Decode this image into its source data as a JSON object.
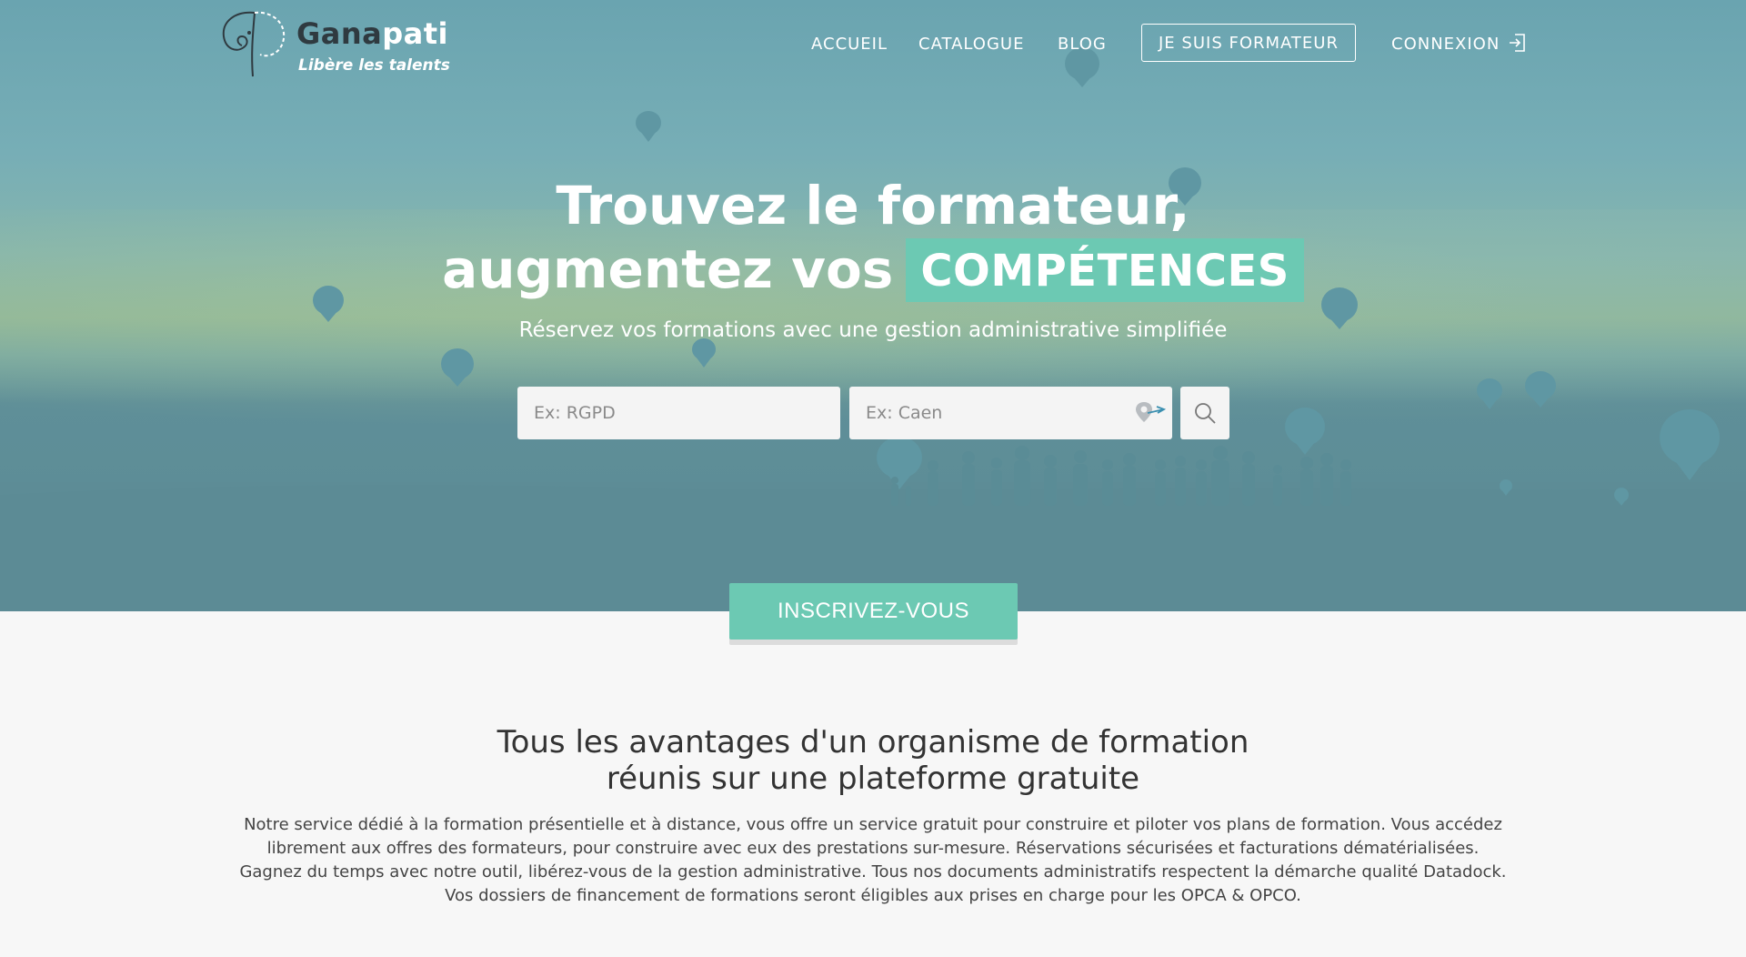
{
  "brand": {
    "name_dark": "Gana",
    "name_light": "pati",
    "tagline": "Libère les talents",
    "accent_color": "#6cc9b3"
  },
  "nav": {
    "home": "ACCUEIL",
    "catalogue": "CATALOGUE",
    "blog": "BLOG",
    "trainer_button": "JE SUIS FORMATEUR",
    "login": "CONNEXION",
    "login_icon": "login-icon"
  },
  "hero": {
    "title_line1": "Trouvez le formateur,",
    "title_line2": "augmentez vos",
    "title_highlight": "COMPÉTENCES",
    "subtitle": "Réservez vos formations avec une gestion administrative simplifiée"
  },
  "search": {
    "what_placeholder": "Ex: RGPD",
    "where_placeholder": "Ex: Caen",
    "geo_icon": "geolocation-icon",
    "search_icon": "search-icon"
  },
  "signup": {
    "label": "INSCRIVEZ-VOUS"
  },
  "advantages": {
    "title_line1": "Tous les avantages d'un organisme de formation",
    "title_line2": "réunis sur une plateforme gratuite",
    "paragraph1": "Notre service dédié à la formation présentielle et à distance, vous offre un service gratuit pour construire et piloter vos plans de formation. Vous accédez librement aux offres des formateurs, pour construire avec eux des prestations sur-mesure. Réservations sécurisées et facturations dématérialisées.",
    "paragraph2": "Gagnez du temps avec notre outil, libérez-vous de la gestion administrative. Tous nos documents administratifs respectent la démarche qualité Datadock. Vos dossiers de financement de formations seront éligibles aux prises en charge pour les OPCA & OPCO."
  }
}
